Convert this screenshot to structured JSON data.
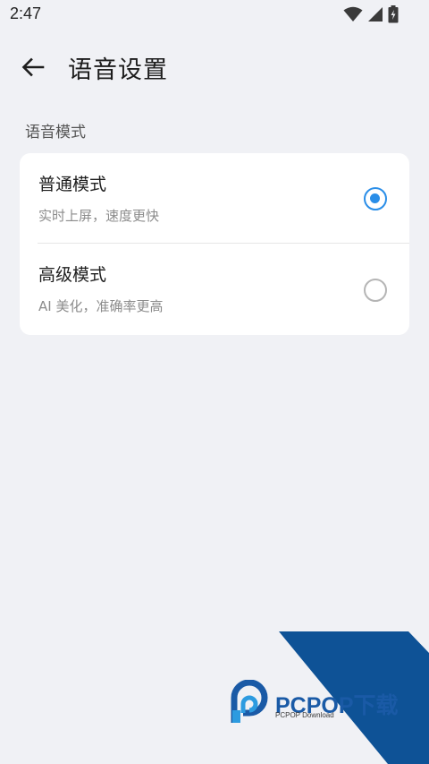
{
  "status_bar": {
    "time": "2:47",
    "icons": [
      "wifi-icon",
      "signal-icon",
      "battery-icon"
    ]
  },
  "header": {
    "back_icon": "arrow-left-icon",
    "title": "语音设置"
  },
  "section": {
    "title": "语音模式"
  },
  "options": [
    {
      "title": "普通模式",
      "subtitle": "实时上屏，速度更快",
      "selected": true
    },
    {
      "title": "高级模式",
      "subtitle": "AI 美化，准确率更高",
      "selected": false
    }
  ],
  "watermark": {
    "brand": "PCPOP下载",
    "subtitle": "PCPOP Download"
  },
  "colors": {
    "background": "#f0f1f5",
    "card": "#ffffff",
    "accent": "#2a8ee8",
    "watermark_blue": "#1a5aa6"
  }
}
